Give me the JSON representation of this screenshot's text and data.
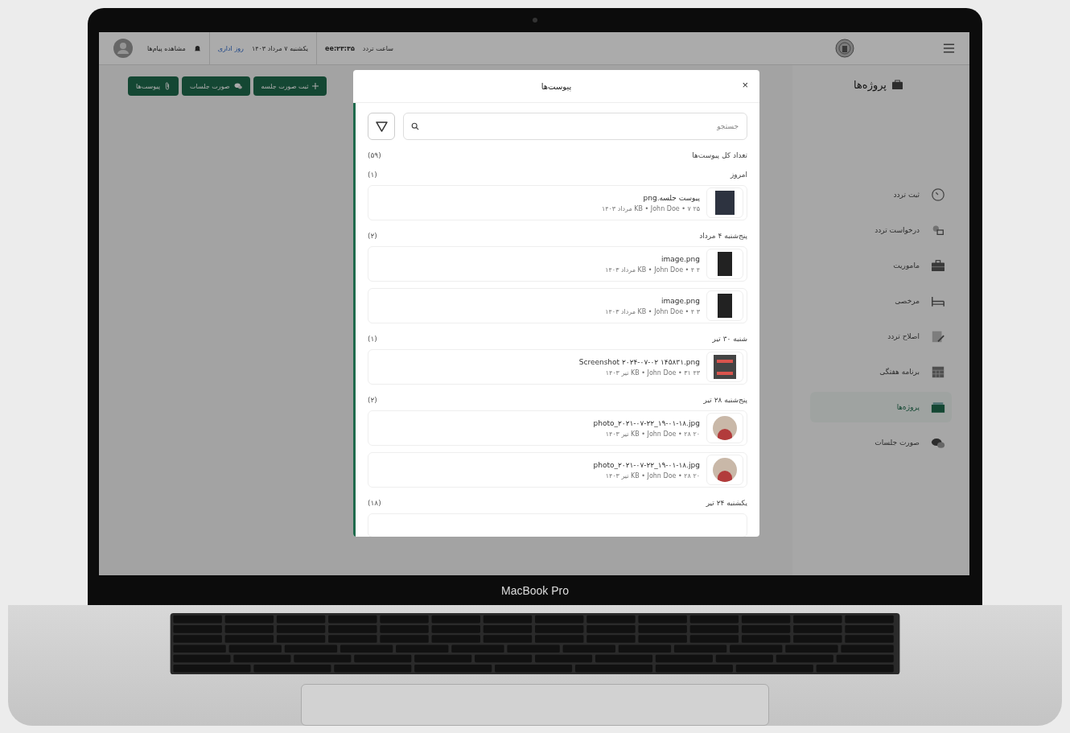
{
  "device": {
    "label": "MacBook Pro"
  },
  "header": {
    "clock_label": "ساعت تردد",
    "clock_time": "ee:۲۳:۳۵",
    "date": "یکشنبه ۷ مرداد ۱۴۰۳",
    "day_link": "روز اداری",
    "messages": "مشاهده پیام‌ها"
  },
  "page": {
    "title": "پروژه‌ها"
  },
  "actions": [
    {
      "label": "ثبت صورت جلسه",
      "kind": "add"
    },
    {
      "label": "صورت جلسات",
      "kind": "chat"
    },
    {
      "label": "پیوست‌ها",
      "kind": "clip"
    }
  ],
  "sidebar": {
    "items": [
      {
        "label": "ثبت تردد",
        "kind": "clock",
        "selected": false
      },
      {
        "label": "درخواست تردد",
        "kind": "request",
        "selected": false
      },
      {
        "label": "ماموریت",
        "kind": "briefcase",
        "selected": false
      },
      {
        "label": "مرخصی",
        "kind": "bed",
        "selected": false
      },
      {
        "label": "اصلاح تردد",
        "kind": "edit",
        "selected": false
      },
      {
        "label": "برنامه هفتگی",
        "kind": "calendar",
        "selected": false
      },
      {
        "label": "پروژه‌ها",
        "kind": "folder",
        "selected": true
      },
      {
        "label": "صورت جلسات",
        "kind": "chat",
        "selected": false
      }
    ]
  },
  "modal": {
    "title": "پیوست‌ها",
    "close": "×",
    "search": {
      "placeholder": "جستجو"
    },
    "total_label": "تعداد کل پیوست‌ها",
    "total_count": "(۵۹)",
    "groups": [
      {
        "title": "امروز",
        "count": "(۱)",
        "files": [
          {
            "name": "پیوست جلسه.png",
            "meta": "۲۵ KB • John Doe • ۷ مرداد ۱۴۰۳",
            "kind": "dark"
          }
        ]
      },
      {
        "title": "پنج‌شنبه ۴ مرداد",
        "count": "(۲)",
        "files": [
          {
            "name": "image.png",
            "meta": "۴ KB • John Doe • ۴ مرداد ۱۴۰۳",
            "kind": "narrow"
          },
          {
            "name": "image.png",
            "meta": "۳ KB • John Doe • ۴ مرداد ۱۴۰۳",
            "kind": "narrow"
          }
        ]
      },
      {
        "title": "شنبه ۳۰ تیر",
        "count": "(۱)",
        "files": [
          {
            "name": "Screenshot ۲۰۲۴-۰۷-۰۲ ۱۴۵۸۳۱.png",
            "meta": "۴۳ KB • John Doe • ۳۱ تیر ۱۴۰۳",
            "kind": "screenshot"
          }
        ]
      },
      {
        "title": "پنج‌شنبه ۲۸ تیر",
        "count": "(۲)",
        "files": [
          {
            "name": "photo_۲۰۲۱-۰۷-۲۲_۱۹-۰۱-۱۸.jpg",
            "meta": "۲۰ KB • John Doe • ۲۸ تیر ۱۴۰۳",
            "kind": "photo"
          },
          {
            "name": "photo_۲۰۲۱-۰۷-۲۲_۱۹-۰۱-۱۸.jpg",
            "meta": "۲۰ KB • John Doe • ۲۸ تیر ۱۴۰۳",
            "kind": "photo"
          }
        ]
      },
      {
        "title": "یکشنبه ۲۴ تیر",
        "count": "(۱۸)"
      }
    ]
  }
}
